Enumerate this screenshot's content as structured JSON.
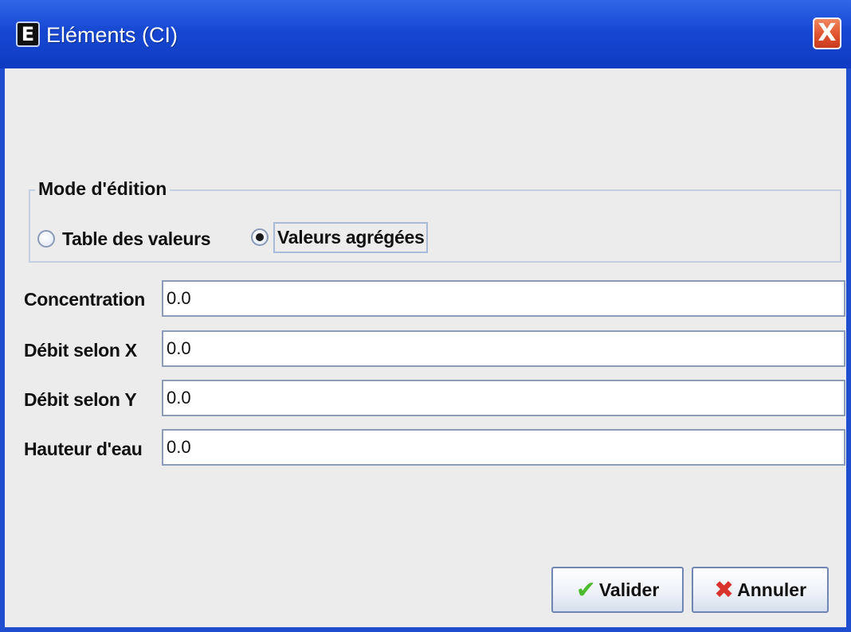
{
  "window": {
    "title": "Eléments (CI)",
    "app_icon_letter": "E",
    "close_glyph": "X"
  },
  "edit_mode": {
    "legend": "Mode d'édition",
    "options": [
      {
        "label": "Table des valeurs",
        "checked": false
      },
      {
        "label": "Valeurs agrégées",
        "checked": true
      }
    ]
  },
  "fields": [
    {
      "label": "Concentration",
      "value": "0.0"
    },
    {
      "label": "Débit selon X",
      "value": "0.0"
    },
    {
      "label": "Débit selon Y",
      "value": "0.0"
    },
    {
      "label": "Hauteur d'eau",
      "value": "0.0"
    }
  ],
  "buttons": {
    "validate": {
      "label": "Valider",
      "icon": "check-icon"
    },
    "cancel": {
      "label": "Annuler",
      "icon": "cross-icon"
    }
  },
  "colors": {
    "titlebar": "#1747d2",
    "window_bg": "#ececec",
    "close_button": "#e0532f"
  }
}
